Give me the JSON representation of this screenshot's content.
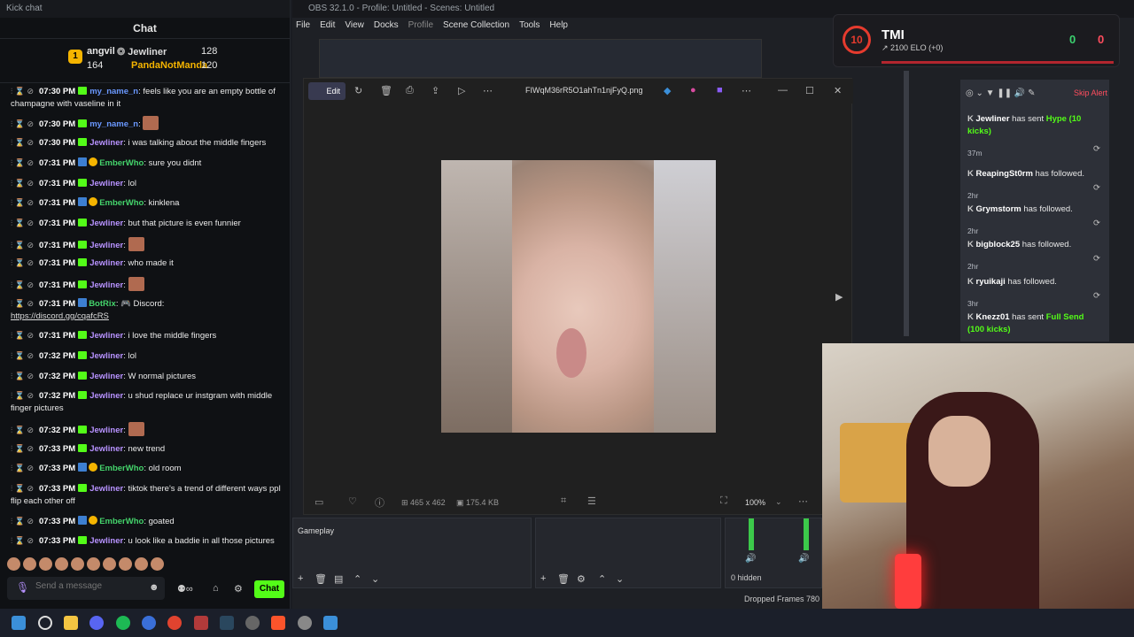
{
  "kick": {
    "window_title": "Kick chat",
    "header": "Chat",
    "leaderboard": [
      {
        "name": "angvil",
        "rank": "1"
      },
      {
        "name": "Jewliner",
        "count": "128"
      },
      {
        "name": "PandaNotManda",
        "count": "120"
      },
      {
        "count": "164"
      }
    ],
    "messages": [
      {
        "time": "07:30 PM",
        "user": "my_name_n",
        "text": "feels like you are an empty bottle of champagne with vaseline in it"
      },
      {
        "time": "07:30 PM",
        "user": "my_name_n",
        "text": ""
      },
      {
        "time": "07:30 PM",
        "user": "Jewliner",
        "text": "i was talking about the middle fingers"
      },
      {
        "time": "07:31 PM",
        "user": "EmberWho",
        "text": "sure you didnt"
      },
      {
        "time": "07:31 PM",
        "user": "Jewliner",
        "text": "lol"
      },
      {
        "time": "07:31 PM",
        "user": "EmberWho",
        "text": "kinklena"
      },
      {
        "time": "07:31 PM",
        "user": "Jewliner",
        "text": "but that picture is even funnier"
      },
      {
        "time": "07:31 PM",
        "user": "Jewliner",
        "text": ""
      },
      {
        "time": "07:31 PM",
        "user": "Jewliner",
        "text": "who made it"
      },
      {
        "time": "07:31 PM",
        "user": "Jewliner",
        "text": ""
      },
      {
        "time": "07:31 PM",
        "user": "BotRix",
        "text": "🎮 Discord:",
        "link": "https://discord.gg/cqafcRS"
      },
      {
        "time": "07:31 PM",
        "user": "Jewliner",
        "text": "i love the middle fingers"
      },
      {
        "time": "07:32 PM",
        "user": "Jewliner",
        "text": "lol"
      },
      {
        "time": "07:32 PM",
        "user": "Jewliner",
        "text": "W normal pictures"
      },
      {
        "time": "07:32 PM",
        "user": "Jewliner",
        "text": "u shud replace ur instgram with middle finger pictures"
      },
      {
        "time": "07:32 PM",
        "user": "Jewliner",
        "text": ""
      },
      {
        "time": "07:33 PM",
        "user": "Jewliner",
        "text": "new trend"
      },
      {
        "time": "07:33 PM",
        "user": "EmberWho",
        "text": "old room"
      },
      {
        "time": "07:33 PM",
        "user": "Jewliner",
        "text": "tiktok there's a trend of different ways ppl flip each other off"
      },
      {
        "time": "07:33 PM",
        "user": "EmberWho",
        "text": "goated"
      },
      {
        "time": "07:33 PM",
        "user": "Jewliner",
        "text": "u look like a baddie in all those pictures"
      }
    ],
    "input_placeholder": "Send a message",
    "chat_button": "Chat"
  },
  "obs": {
    "window_title": "OBS 32.1.0 - Profile: Untitled - Scenes: Untitled",
    "menu": [
      "File",
      "Edit",
      "View",
      "Docks",
      "Profile",
      "Scene Collection",
      "Tools",
      "Help"
    ],
    "scene_item": "Gameplay",
    "hidden_label": "0 hidden",
    "status": "Dropped Frames 780 ("
  },
  "viewer": {
    "edit_label": "Edit",
    "filename": "FIWqM36rR5O1ahTn1njFyQ.png",
    "dimensions": "465 x 462",
    "filesize": "175.4 KB",
    "zoom": "100%"
  },
  "overlay": {
    "level": "10",
    "name": "TMI",
    "elo": "↗ 2100 ELO (+0)",
    "wins": "0",
    "losses": "0"
  },
  "alerts": {
    "skip_label": "Skip Alert",
    "items": [
      {
        "user": "Jewliner",
        "text": "has sent",
        "amount": "Hype (10 kicks)",
        "time": "37m"
      },
      {
        "user": "ReapingSt0rm",
        "text": "has followed.",
        "time": "2hr"
      },
      {
        "user": "Grymstorm",
        "text": "has followed.",
        "time": "2hr"
      },
      {
        "user": "bigblock25",
        "text": "has followed.",
        "time": "2hr"
      },
      {
        "user": "ryuikaji",
        "text": "has followed.",
        "time": "3hr"
      },
      {
        "user": "Knezz01",
        "text": "has sent",
        "amount": "Full Send (100 kicks)",
        "time": ""
      }
    ]
  },
  "colors": {
    "kick_green": "#53fc18",
    "alert_red": "#ff4d5e",
    "username_purple": "#b792ff"
  }
}
